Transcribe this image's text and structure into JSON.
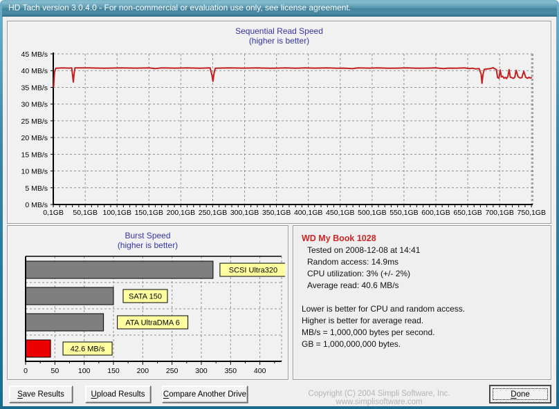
{
  "window": {
    "title": "HD Tach version 3.0.4.0  - For non-commercial or evaluation use only, see license agreement."
  },
  "info": {
    "drive_name": "WD My Book 1028",
    "stats": {
      "0": "Tested on 2008-12-08 at 14:41",
      "1": "Random access: 14.9ms",
      "2": "CPU utilization: 3% (+/- 2%)",
      "3": "Average read: 40.6 MB/s"
    },
    "notes": {
      "0": "Lower is better for CPU and random access.",
      "1": "Higher is better for average read.",
      "2": "MB/s = 1,000,000 bytes per second.",
      "3": "GB = 1,000,000,000 bytes."
    }
  },
  "buttons": {
    "save": "Save Results",
    "upload": "Upload Results",
    "compare": "Compare Another Drive",
    "done": "Done"
  },
  "footer": {
    "copyright": "Copyright (C) 2004 Simpli Software, Inc. www.simplisoftware.com"
  },
  "colors": {
    "line": "#c22020",
    "bar_gray": "#7f7f7f",
    "bar_red": "#ee0000",
    "label_bg": "#ffffa0",
    "grid": "#909090",
    "chart_title": "#3434a4",
    "drive_name": "#cc2626"
  },
  "chart_data": [
    {
      "type": "line",
      "title": "Sequential Read Speed",
      "subtitle": "(higher is better)",
      "ylabel_unit": "MB/s",
      "ylim": [
        0,
        45
      ],
      "yticks": [
        {
          "value": 0,
          "label": "0 MB/s"
        },
        {
          "value": 5,
          "label": "5 MB/s"
        },
        {
          "value": 10,
          "label": "10 MB/s"
        },
        {
          "value": 15,
          "label": "15 MB/s"
        },
        {
          "value": 20,
          "label": "20 MB/s"
        },
        {
          "value": 25,
          "label": "25 MB/s"
        },
        {
          "value": 30,
          "label": "30 MB/s"
        },
        {
          "value": 35,
          "label": "35 MB/s"
        },
        {
          "value": 40,
          "label": "40 MB/s"
        },
        {
          "value": 45,
          "label": "45 MB/s"
        }
      ],
      "xlim": [
        0,
        752
      ],
      "xticks": [
        {
          "value": 0.1,
          "label": "0,1GB"
        },
        {
          "value": 50.1,
          "label": "50,1GB"
        },
        {
          "value": 100.1,
          "label": "100,1GB"
        },
        {
          "value": 150.1,
          "label": "150,1GB"
        },
        {
          "value": 200.1,
          "label": "200,1GB"
        },
        {
          "value": 250.1,
          "label": "250,1GB"
        },
        {
          "value": 300.1,
          "label": "300,1GB"
        },
        {
          "value": 350.1,
          "label": "350,1GB"
        },
        {
          "value": 400.1,
          "label": "400,1GB"
        },
        {
          "value": 450.1,
          "label": "450,1GB"
        },
        {
          "value": 500.1,
          "label": "500,1GB"
        },
        {
          "value": 550.1,
          "label": "550,1GB"
        },
        {
          "value": 600.1,
          "label": "600,1GB"
        },
        {
          "value": 650.1,
          "label": "650,1GB"
        },
        {
          "value": 700.1,
          "label": "700,1GB"
        },
        {
          "value": 750.1,
          "label": "750,1GB"
        }
      ],
      "grid": "dashed",
      "points": [
        [
          0.5,
          35.2
        ],
        [
          2,
          39.5
        ],
        [
          4,
          40.7
        ],
        [
          15,
          40.8
        ],
        [
          25,
          40.75
        ],
        [
          29,
          40.8
        ],
        [
          30.5,
          38.2
        ],
        [
          31.5,
          36.6
        ],
        [
          32.5,
          38.8
        ],
        [
          34,
          40.8
        ],
        [
          55,
          40.8
        ],
        [
          80,
          40.7
        ],
        [
          105,
          40.8
        ],
        [
          130,
          40.75
        ],
        [
          150,
          40.8
        ],
        [
          160,
          40.6
        ],
        [
          170,
          40.8
        ],
        [
          190,
          40.75
        ],
        [
          210,
          40.8
        ],
        [
          230,
          40.7
        ],
        [
          246,
          40.8
        ],
        [
          249,
          38.5
        ],
        [
          250.5,
          36.8
        ],
        [
          252,
          39
        ],
        [
          254,
          40.7
        ],
        [
          275,
          40.8
        ],
        [
          300,
          40.75
        ],
        [
          320,
          40.8
        ],
        [
          340,
          40.7
        ],
        [
          350,
          40.75
        ],
        [
          365,
          40.8
        ],
        [
          380,
          40.7
        ],
        [
          395,
          40.8
        ],
        [
          410,
          40.75
        ],
        [
          430,
          40.8
        ],
        [
          445,
          40.7
        ],
        [
          455,
          40.75
        ],
        [
          470,
          40.6
        ],
        [
          478,
          40.8
        ],
        [
          495,
          40.75
        ],
        [
          510,
          40.8
        ],
        [
          525,
          40.7
        ],
        [
          540,
          40.75
        ],
        [
          555,
          40.8
        ],
        [
          570,
          40.7
        ],
        [
          585,
          40.75
        ],
        [
          600,
          40.8
        ],
        [
          612,
          40.6
        ],
        [
          620,
          40.75
        ],
        [
          632,
          40.7
        ],
        [
          645,
          40.8
        ],
        [
          652,
          40.6
        ],
        [
          658,
          40.7
        ],
        [
          663,
          40.5
        ],
        [
          668,
          40.6
        ],
        [
          671,
          39
        ],
        [
          672.5,
          36.2
        ],
        [
          674,
          38.8
        ],
        [
          676,
          40.4
        ],
        [
          681,
          40.5
        ],
        [
          686,
          40.6
        ],
        [
          690,
          40.9
        ],
        [
          692,
          40.6
        ],
        [
          695,
          40.3
        ],
        [
          697,
          37.9
        ],
        [
          699,
          37.7
        ],
        [
          701,
          40.2
        ],
        [
          703,
          38.1
        ],
        [
          705,
          38.3
        ],
        [
          707,
          37.7
        ],
        [
          709,
          38.0
        ],
        [
          711,
          37.6
        ],
        [
          713,
          38.3
        ],
        [
          715,
          40.3
        ],
        [
          717,
          38.0
        ],
        [
          719,
          37.9
        ],
        [
          722,
          37.7
        ],
        [
          724,
          38.1
        ],
        [
          726,
          40.1
        ],
        [
          729,
          38.2
        ],
        [
          732,
          37.8
        ],
        [
          735,
          37.9
        ],
        [
          738,
          39.8
        ],
        [
          741,
          38.0
        ],
        [
          744,
          37.7
        ],
        [
          746,
          38.0
        ],
        [
          748,
          37.8
        ],
        [
          750,
          37.9
        ]
      ]
    },
    {
      "type": "bar",
      "orientation": "horizontal",
      "title": "Burst Speed",
      "subtitle": "(higher is better)",
      "xlim": [
        0,
        437
      ],
      "xticks": [
        0,
        50,
        100,
        150,
        200,
        250,
        300,
        350,
        400
      ],
      "grid": "dashed",
      "bars": [
        {
          "label": "SCSI Ultra320",
          "value": 320,
          "color": "#7f7f7f",
          "label_offset": 10
        },
        {
          "label": "SATA 150",
          "value": 150,
          "color": "#7f7f7f",
          "label_offset": 14
        },
        {
          "label": "ATA UltraDMA 6",
          "value": 133,
          "color": "#7f7f7f",
          "label_offset": 20
        },
        {
          "label": "42.6 MB/s",
          "value": 42.6,
          "color": "#ee0000",
          "label_offset": 18
        }
      ]
    }
  ]
}
